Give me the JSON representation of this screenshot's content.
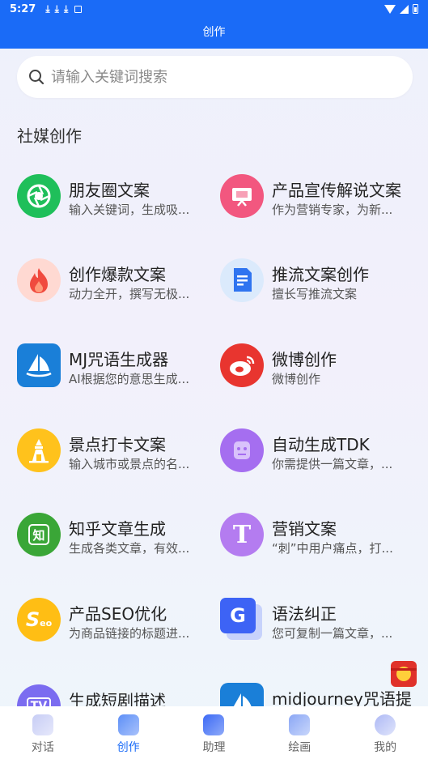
{
  "status_bar": {
    "time": "5:27"
  },
  "header": {
    "title": "创作"
  },
  "search": {
    "placeholder": "请输入关键词搜索"
  },
  "section": {
    "title": "社媒创作"
  },
  "items": [
    {
      "name": "朋友圈文案",
      "desc": "输入关键词，生成吸...",
      "icon": "camera-aperture-icon",
      "color": "#1fbf5a"
    },
    {
      "name": "产品宣传解说文案",
      "desc": "作为营销专家，为新...",
      "icon": "presentation-icon",
      "color": "#f2577f"
    },
    {
      "name": "创作爆款文案",
      "desc": "动力全开，撰写无极...",
      "icon": "flame-icon",
      "color": "#ffd9d2"
    },
    {
      "name": "推流文案创作",
      "desc": "擅长写推流文案",
      "icon": "document-icon",
      "color": "#dbeafc"
    },
    {
      "name": "MJ咒语生成器",
      "desc": "AI根据您的意思生成...",
      "icon": "sailboat-icon",
      "color": "#1a7fd8"
    },
    {
      "name": "微博创作",
      "desc": "微博创作",
      "icon": "weibo-icon",
      "color": "#e8352f"
    },
    {
      "name": "景点打卡文案",
      "desc": "输入城市或景点的名...",
      "icon": "landmark-icon",
      "color": "#ffc21c"
    },
    {
      "name": "自动生成TDK",
      "desc": "你需提供一篇文章，...",
      "icon": "robot-icon",
      "color": "#a56ef0"
    },
    {
      "name": "知乎文章生成",
      "desc": "生成各类文章，有效...",
      "icon": "zhihu-icon",
      "color": "#3aa637"
    },
    {
      "name": "营销文案",
      "desc": "“刺”中用户痛点，打...",
      "icon": "letter-t-icon",
      "color": "#b47cf0"
    },
    {
      "name": "产品SEO优化",
      "desc": "为商品链接的标题进...",
      "icon": "seo-icon",
      "color": "#ffbe14"
    },
    {
      "name": "语法纠正",
      "desc": "您可复制一篇文章，...",
      "icon": "grammar-g-icon",
      "color": "#3d63f5"
    },
    {
      "name": "生成短剧描述",
      "desc": "",
      "icon": "tv-icon",
      "color": "#7b6cf0"
    },
    {
      "name": "midjourney咒语提",
      "desc": "",
      "icon": "sailboat-icon",
      "color": "#1a7fd8"
    }
  ],
  "letters": {
    "zhi": "知",
    "t": "T",
    "g": "G",
    "seo": "S",
    "eo": "eo",
    "tv": "TV"
  },
  "nav": {
    "tabs": [
      {
        "label": "对话",
        "icon": "chat-icon"
      },
      {
        "label": "创作",
        "icon": "create-icon",
        "active": true
      },
      {
        "label": "助理",
        "icon": "assistant-icon"
      },
      {
        "label": "绘画",
        "icon": "paint-icon"
      },
      {
        "label": "我的",
        "icon": "profile-icon"
      }
    ]
  },
  "colors": {
    "primary": "#1a6bf7"
  }
}
